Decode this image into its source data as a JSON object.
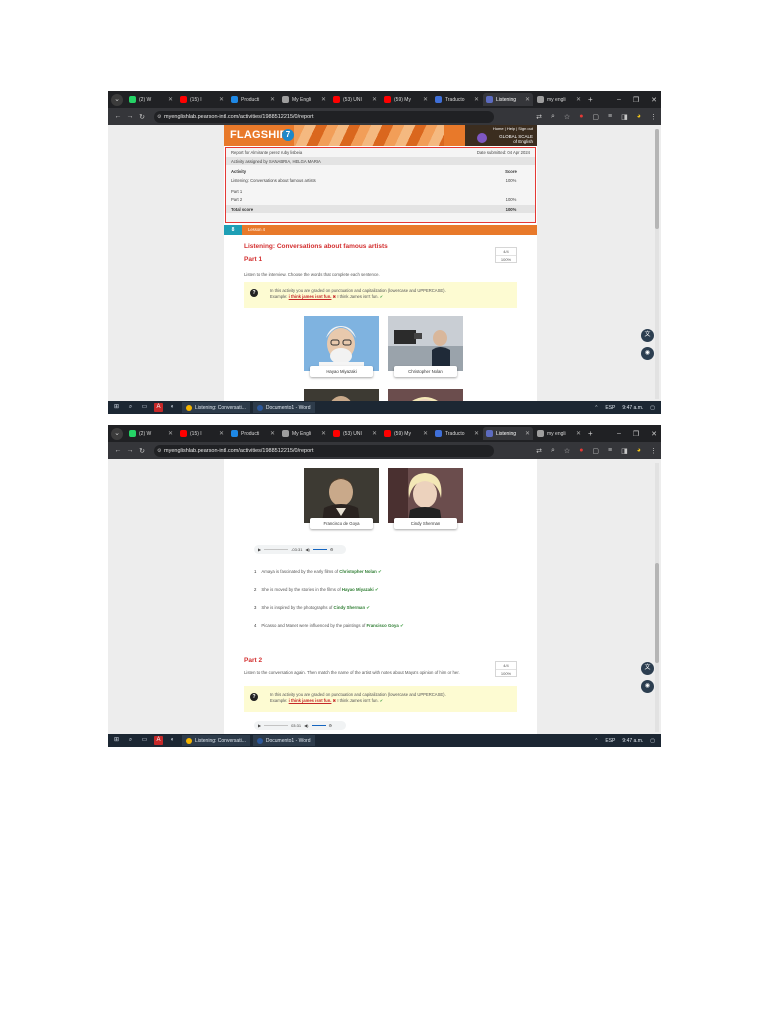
{
  "browser": {
    "tabs": [
      {
        "label": "(2) W",
        "color": "#25d366",
        "active": false
      },
      {
        "label": "(15) I",
        "color": "#ff0000",
        "active": false
      },
      {
        "label": "Producti",
        "color": "#1e88e5",
        "active": false
      },
      {
        "label": "My Engli",
        "color": "#9e9e9e",
        "active": false
      },
      {
        "label": "(53) UNI",
        "color": "#ff0000",
        "active": false
      },
      {
        "label": "(59) My",
        "color": "#ff0000",
        "active": false
      },
      {
        "label": "Traducto",
        "color": "#3f6fd8",
        "active": false
      },
      {
        "label": "Listening",
        "color": "#5c6bc0",
        "active": true
      },
      {
        "label": "my engli",
        "color": "#9e9e9e",
        "active": false
      }
    ],
    "url": "myenglishlab.pearson-intl.com/activities/1988512215/0/report"
  },
  "taskbar": {
    "apps": [
      {
        "label": "Listening: Conversati...",
        "color": "#f4b400"
      },
      {
        "label": "Documento1 - Word",
        "color": "#2b579a"
      }
    ],
    "lang": "ESP",
    "time": "9:47 a.m."
  },
  "header": {
    "logo": "FLAGSHIP",
    "level": "7",
    "links": "Home | Help | Sign out",
    "gse_line1": "GLOBAL SCALE",
    "gse_line2": "of English"
  },
  "report": {
    "title": "Report for Almirante perez ruby lisbeia",
    "date": "Date submitted: 04 Apr 2024",
    "assigned": "Activity assigned by SANABRIA, HELGA MARIA",
    "col_activity": "Activity",
    "col_score": "Score",
    "activity_name": "Listening: Conversations about famous artists",
    "activity_score": "100%",
    "part1": "Part 1",
    "part2": "Part 2",
    "part2_score": "100%",
    "total": "Total score",
    "total_score": "100%"
  },
  "lesson": {
    "num": "8",
    "label": "Lesson 4"
  },
  "activity": {
    "title": "Listening: Conversations about famous artists",
    "part1": "Part 1",
    "score_frac": "4/4",
    "score_pct": "100%",
    "instruction1": "Listen to the interview. Choose the words that complete each sentence.",
    "note_line": "In this activity you are graded on punctuation and capitalization (lowercase and UPPERCASE).",
    "note_example_label": "Example:",
    "note_wrong": "i think james isnt fun.",
    "note_right": "I think James isn't fun.",
    "artists": [
      "Hayao Miyazaki",
      "Christopher Nolan",
      "Francisco de Goya",
      "Cindy Sherman"
    ],
    "audio_time": "-03:31",
    "sentences": [
      {
        "num": "1",
        "text": "Amaya is fascinated by the early films of",
        "answer": "Christopher Nolan"
      },
      {
        "num": "2",
        "text": "She is moved by the stories in the films of",
        "answer": "Hayao Miyazaki"
      },
      {
        "num": "3",
        "text": "She is inspired by the photographs of",
        "answer": "Cindy Sherman"
      },
      {
        "num": "4",
        "text": "Picasso and Manet were influenced by the paintings of",
        "answer": "Francisco Goya"
      }
    ],
    "part2": "Part 2",
    "instruction2": "Listen to the conversation again. Then match the name of the artist with notes about Maya's opinion of him or her.",
    "audio_time2": "03:31"
  }
}
